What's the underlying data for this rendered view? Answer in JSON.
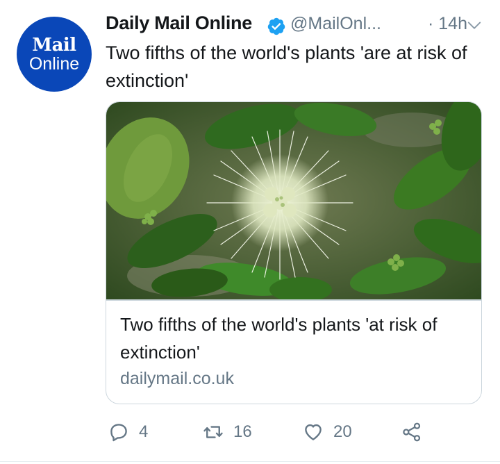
{
  "avatar": {
    "line1": "Mail",
    "line2": "Online"
  },
  "tweet": {
    "display_name": "Daily Mail Online",
    "handle": "@MailOnl...",
    "time": "· 14h",
    "text": "Two fifths of the world's plants 'are at risk of extinction'"
  },
  "card": {
    "title": "Two fifths of the world's plants 'at risk of extinction'",
    "domain": "dailymail.co.uk"
  },
  "actions": {
    "replies": "4",
    "retweets": "16",
    "likes": "20"
  },
  "colors": {
    "avatar_bg": "#0a47b8",
    "verified": "#1da1f2",
    "text_primary": "#14171a",
    "text_secondary": "#657786",
    "border": "#ccd6dd"
  },
  "icons": [
    "verified-badge-icon",
    "chevron-down-icon",
    "reply-icon",
    "retweet-icon",
    "like-icon",
    "share-icon"
  ]
}
